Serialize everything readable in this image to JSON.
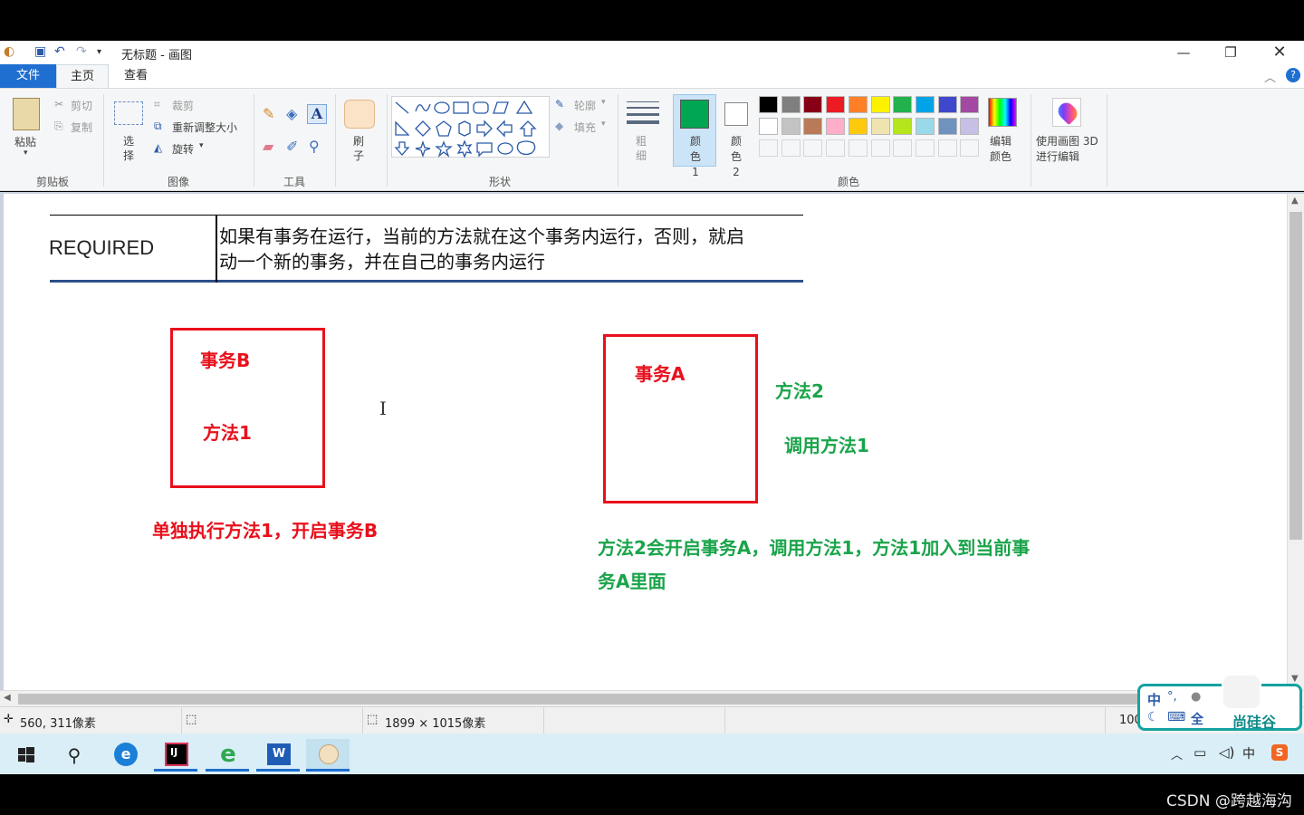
{
  "window": {
    "title": "无标题 - 画图",
    "tabs": [
      "文件",
      "主页",
      "查看"
    ]
  },
  "ribbon": {
    "clipboard": {
      "paste": "粘贴",
      "cut": "剪切",
      "copy": "复制",
      "group": "剪贴板"
    },
    "image": {
      "select": "选择",
      "crop": "裁剪",
      "resize": "重新调整大小",
      "rotate": "旋转",
      "group": "图像"
    },
    "tools": {
      "group": "工具"
    },
    "brush": {
      "label": "刷子"
    },
    "shapes": {
      "outline": "轮廓",
      "fill": "填充",
      "group": "形状"
    },
    "size": {
      "label": "粗细"
    },
    "color1": {
      "label": "颜色 1"
    },
    "color2": {
      "label": "颜色 2"
    },
    "colors": {
      "group": "颜色",
      "row1": [
        "#000000",
        "#7f7f7f",
        "#880015",
        "#ed1c24",
        "#ff7f27",
        "#fff200",
        "#22b14c",
        "#00a2e8",
        "#3f48cc",
        "#a349a4"
      ],
      "row2": [
        "#ffffff",
        "#c3c3c3",
        "#b97a57",
        "#ffaec9",
        "#ffc90e",
        "#efe4b0",
        "#b5e61d",
        "#99d9ea",
        "#7092be",
        "#c8bfe7"
      ]
    },
    "edit_colors": "编辑颜色",
    "paint3d": "使用画图 3D 进行编辑",
    "color1_value": "#00a651",
    "color2_value": "#ffffff"
  },
  "canvas": {
    "table": {
      "name": "REQUIRED",
      "desc_line1": "如果有事务在运行，当前的方法就在这个事务内运行，否则，就启",
      "desc_line2": "动一个新的事务，并在自己的事务内运行"
    },
    "left": {
      "tx": "事务B",
      "method": "方法1",
      "caption": "单独执行方法1，开启事务B"
    },
    "right": {
      "tx": "事务A",
      "method2": "方法2",
      "call": "调用方法1",
      "caption_line1": "方法2会开启事务A，调用方法1，方法1加入到当前事",
      "caption_line2": "务A里面"
    },
    "colors": {
      "red": "#e8101c",
      "green": "#1aa44a"
    }
  },
  "status": {
    "cursor": "560, 311像素",
    "size": "1899 × 1015像素",
    "zoom": "100"
  },
  "overlay": {
    "ime_zh": "中",
    "ime_full": "全",
    "brand": "尚硅谷"
  },
  "watermark": "CSDN @跨越海沟"
}
